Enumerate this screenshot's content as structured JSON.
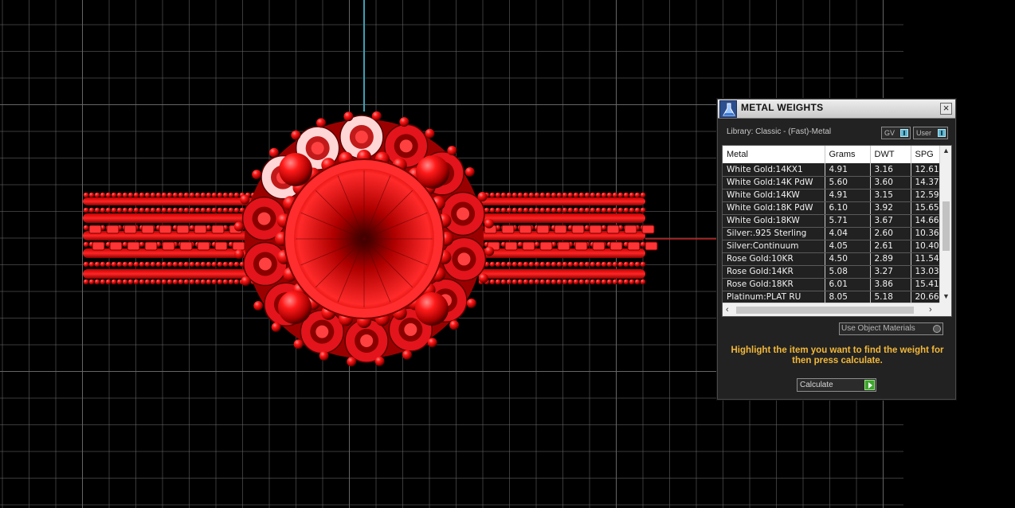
{
  "viewport": {
    "name": "3D viewport",
    "background": "#000000",
    "grid_color": "#6b6b6b",
    "axis_y_color": "#3aa0b4",
    "axis_x_color": "#c02020",
    "model_color": "#e3141b"
  },
  "panel": {
    "title": "METAL WEIGHTS",
    "close_icon": "close-icon",
    "library_label": "Library: Classic - (Fast)-Metal",
    "toggles": [
      {
        "label": "GV"
      },
      {
        "label": "User"
      }
    ],
    "table": {
      "columns": [
        "Metal",
        "Grams",
        "DWT",
        "SPG"
      ],
      "rows": [
        {
          "metal": "White Gold:14KX1",
          "grams": "4.91",
          "dwt": "3.16",
          "spg": "12.61"
        },
        {
          "metal": "White Gold:14K PdW",
          "grams": "5.60",
          "dwt": "3.60",
          "spg": "14.37"
        },
        {
          "metal": "White Gold:14KW",
          "grams": "4.91",
          "dwt": "3.15",
          "spg": "12.59"
        },
        {
          "metal": "White Gold:18K PdW",
          "grams": "6.10",
          "dwt": "3.92",
          "spg": "15.65"
        },
        {
          "metal": "White Gold:18KW",
          "grams": "5.71",
          "dwt": "3.67",
          "spg": "14.66"
        },
        {
          "metal": "Silver:.925 Sterling",
          "grams": "4.04",
          "dwt": "2.60",
          "spg": "10.36"
        },
        {
          "metal": "Silver:Continuum",
          "grams": "4.05",
          "dwt": "2.61",
          "spg": "10.40"
        },
        {
          "metal": "Rose Gold:10KR",
          "grams": "4.50",
          "dwt": "2.89",
          "spg": "11.54"
        },
        {
          "metal": "Rose Gold:14KR",
          "grams": "5.08",
          "dwt": "3.27",
          "spg": "13.03"
        },
        {
          "metal": "Rose Gold:18KR",
          "grams": "6.01",
          "dwt": "3.86",
          "spg": "15.41"
        },
        {
          "metal": "Platinum:PLAT RU",
          "grams": "8.05",
          "dwt": "5.18",
          "spg": "20.66"
        }
      ]
    },
    "use_object_materials": "Use Object Materials",
    "hint": "Highlight the item you want to find the weight for then press calculate.",
    "calculate_label": "Calculate",
    "accent_color": "#f2b83a"
  }
}
